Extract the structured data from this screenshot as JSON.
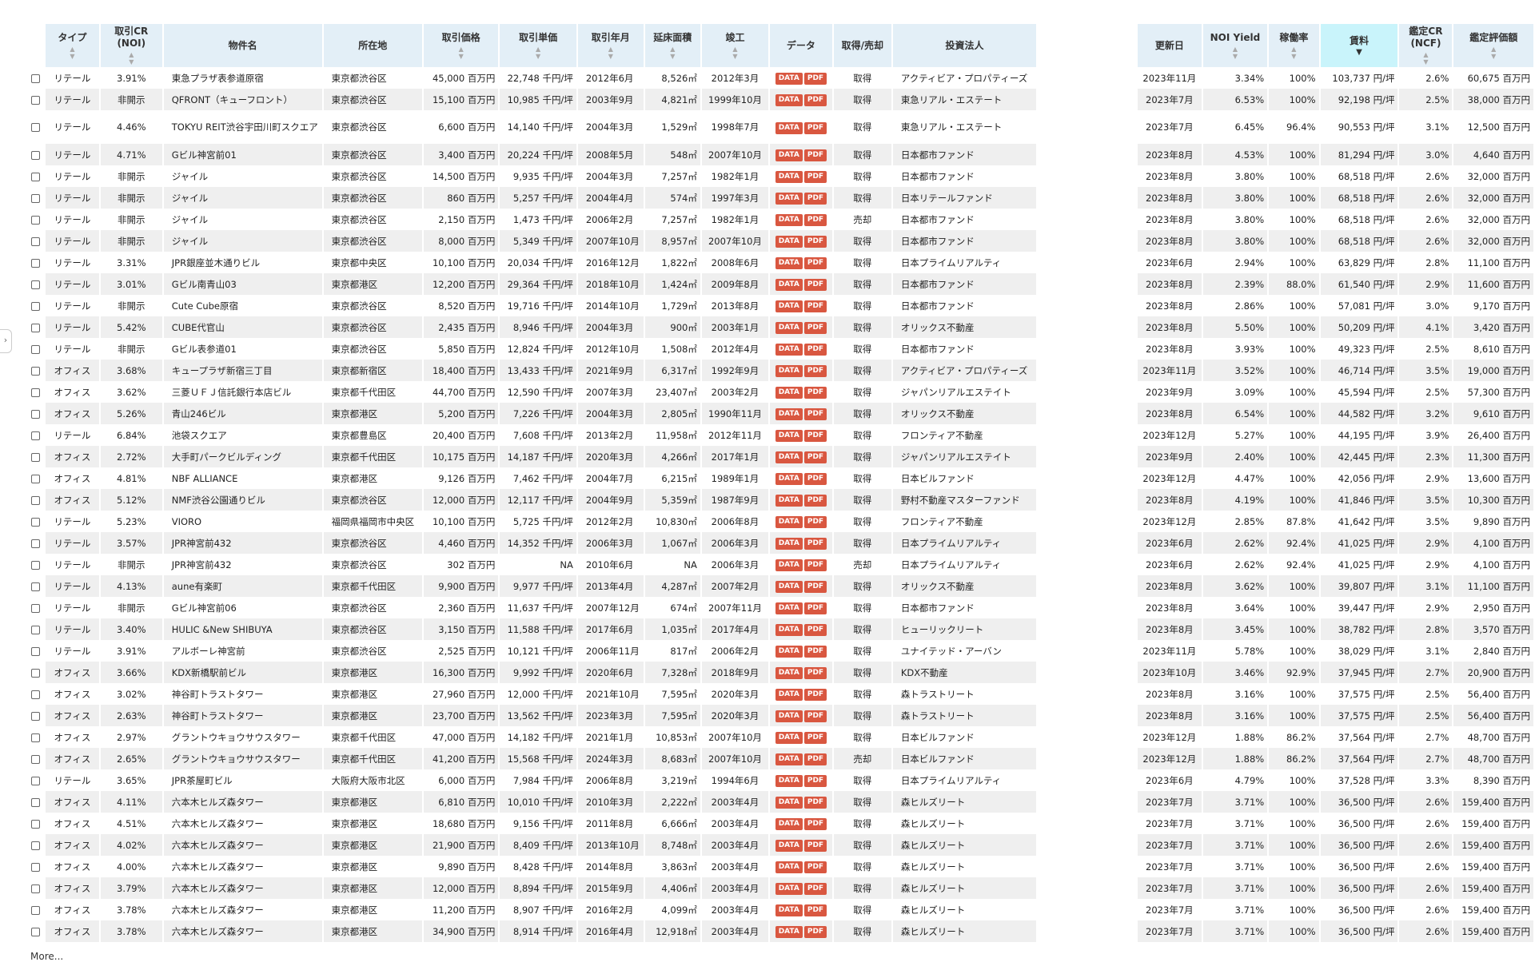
{
  "more_label": "More...",
  "sidebar_toggle": "›",
  "headers": {
    "type": "タイプ",
    "cr_noi_1": "取引CR",
    "cr_noi_2": "(NOI)",
    "name": "物件名",
    "location": "所在地",
    "price": "取引価格",
    "unit_price": "取引単価",
    "date": "取引年月",
    "area": "延床面積",
    "built": "竣工",
    "data": "データ",
    "acq": "取得/売却",
    "investor": "投資法人",
    "updated": "更新日",
    "noi_yield": "NOI Yield",
    "occupancy": "稼働率",
    "rent": "賃料",
    "cr_ncf_1": "鑑定CR",
    "cr_ncf_2": "(NCF)",
    "appraisal": "鑑定評価額"
  },
  "buttons": {
    "data": "DATA",
    "pdf": "PDF"
  },
  "colors": {
    "header_bg": "#e3eff7",
    "sorted_header_bg": "#c9f4fb",
    "row_alt_bg": "#efefef",
    "button": "#d95740"
  },
  "rows": [
    [
      "リテール",
      "3.91%",
      "東急プラザ表参道原宿",
      "東京都渋谷区",
      "45,000 百万円",
      "22,748 千円/坪",
      "2012年6月",
      "8,526㎡",
      "2012年3月",
      "取得",
      "アクティビア・プロパティーズ",
      "2023年11月",
      "3.34%",
      "100%",
      "103,737 円/坪",
      "2.6%",
      "60,675 百万円"
    ],
    [
      "リテール",
      "非開示",
      "QFRONT（キューフロント）",
      "東京都渋谷区",
      "15,100 百万円",
      "10,985 千円/坪",
      "2003年9月",
      "4,821㎡",
      "1999年10月",
      "取得",
      "東急リアル・エステート",
      "2023年7月",
      "6.53%",
      "100%",
      "92,198 円/坪",
      "2.5%",
      "38,000 百万円"
    ],
    [
      "リテール",
      "4.46%",
      "TOKYU REIT渋谷宇田川町スクエア",
      "東京都渋谷区",
      "6,600 百万円",
      "14,140 千円/坪",
      "2004年3月",
      "1,529㎡",
      "1998年7月",
      "取得",
      "東急リアル・エステート",
      "2023年7月",
      "6.45%",
      "96.4%",
      "90,553 円/坪",
      "3.1%",
      "12,500 百万円"
    ],
    [
      "リテール",
      "4.71%",
      "Gビル神宮前01",
      "東京都渋谷区",
      "3,400 百万円",
      "20,224 千円/坪",
      "2008年5月",
      "548㎡",
      "2007年10月",
      "取得",
      "日本都市ファンド",
      "2023年8月",
      "4.53%",
      "100%",
      "81,294 円/坪",
      "3.0%",
      "4,640 百万円"
    ],
    [
      "リテール",
      "非開示",
      "ジャイル",
      "東京都渋谷区",
      "14,500 百万円",
      "9,935 千円/坪",
      "2004年3月",
      "7,257㎡",
      "1982年1月",
      "取得",
      "日本都市ファンド",
      "2023年8月",
      "3.80%",
      "100%",
      "68,518 円/坪",
      "2.6%",
      "32,000 百万円"
    ],
    [
      "リテール",
      "非開示",
      "ジャイル",
      "東京都渋谷区",
      "860 百万円",
      "5,257 千円/坪",
      "2004年4月",
      "574㎡",
      "1997年3月",
      "取得",
      "日本リテールファンド",
      "2023年8月",
      "3.80%",
      "100%",
      "68,518 円/坪",
      "2.6%",
      "32,000 百万円"
    ],
    [
      "リテール",
      "非開示",
      "ジャイル",
      "東京都渋谷区",
      "2,150 百万円",
      "1,473 千円/坪",
      "2006年2月",
      "7,257㎡",
      "1982年1月",
      "売却",
      "日本都市ファンド",
      "2023年8月",
      "3.80%",
      "100%",
      "68,518 円/坪",
      "2.6%",
      "32,000 百万円"
    ],
    [
      "リテール",
      "非開示",
      "ジャイル",
      "東京都渋谷区",
      "8,000 百万円",
      "5,349 千円/坪",
      "2007年10月",
      "8,957㎡",
      "2007年10月",
      "取得",
      "日本都市ファンド",
      "2023年8月",
      "3.80%",
      "100%",
      "68,518 円/坪",
      "2.6%",
      "32,000 百万円"
    ],
    [
      "リテール",
      "3.31%",
      "JPR銀座並木通りビル",
      "東京都中央区",
      "10,100 百万円",
      "20,034 千円/坪",
      "2016年12月",
      "1,822㎡",
      "2008年6月",
      "取得",
      "日本プライムリアルティ",
      "2023年6月",
      "2.94%",
      "100%",
      "63,829 円/坪",
      "2.8%",
      "11,100 百万円"
    ],
    [
      "リテール",
      "3.01%",
      "Gビル南青山03",
      "東京都港区",
      "12,200 百万円",
      "29,364 千円/坪",
      "2018年10月",
      "1,424㎡",
      "2009年8月",
      "取得",
      "日本都市ファンド",
      "2023年8月",
      "2.39%",
      "88.0%",
      "61,540 円/坪",
      "2.9%",
      "11,600 百万円"
    ],
    [
      "リテール",
      "非開示",
      "Cute Cube原宿",
      "東京都渋谷区",
      "8,520 百万円",
      "19,716 千円/坪",
      "2014年10月",
      "1,729㎡",
      "2013年8月",
      "取得",
      "日本都市ファンド",
      "2023年8月",
      "2.86%",
      "100%",
      "57,081 円/坪",
      "3.0%",
      "9,170 百万円"
    ],
    [
      "リテール",
      "5.42%",
      "CUBE代官山",
      "東京都渋谷区",
      "2,435 百万円",
      "8,946 千円/坪",
      "2004年3月",
      "900㎡",
      "2003年1月",
      "取得",
      "オリックス不動産",
      "2023年8月",
      "5.50%",
      "100%",
      "50,209 円/坪",
      "4.1%",
      "3,420 百万円"
    ],
    [
      "リテール",
      "非開示",
      "Gビル表参道01",
      "東京都渋谷区",
      "5,850 百万円",
      "12,824 千円/坪",
      "2012年10月",
      "1,508㎡",
      "2012年4月",
      "取得",
      "日本都市ファンド",
      "2023年8月",
      "3.93%",
      "100%",
      "49,323 円/坪",
      "2.5%",
      "8,610 百万円"
    ],
    [
      "オフィス",
      "3.68%",
      "キュープラザ新宿三丁目",
      "東京都新宿区",
      "18,400 百万円",
      "13,433 千円/坪",
      "2021年9月",
      "6,317㎡",
      "1992年9月",
      "取得",
      "アクティビア・プロパティーズ",
      "2023年11月",
      "3.52%",
      "100%",
      "46,714 円/坪",
      "3.5%",
      "19,000 百万円"
    ],
    [
      "オフィス",
      "3.62%",
      "三菱ＵＦＪ信託銀行本店ビル",
      "東京都千代田区",
      "44,700 百万円",
      "12,590 千円/坪",
      "2007年3月",
      "23,407㎡",
      "2003年2月",
      "取得",
      "ジャパンリアルエステイト",
      "2023年9月",
      "3.09%",
      "100%",
      "45,594 円/坪",
      "2.5%",
      "57,300 百万円"
    ],
    [
      "オフィス",
      "5.26%",
      "青山246ビル",
      "東京都港区",
      "5,200 百万円",
      "7,226 千円/坪",
      "2004年3月",
      "2,805㎡",
      "1990年11月",
      "取得",
      "オリックス不動産",
      "2023年8月",
      "6.54%",
      "100%",
      "44,582 円/坪",
      "3.2%",
      "9,610 百万円"
    ],
    [
      "リテール",
      "6.84%",
      "池袋スクエア",
      "東京都豊島区",
      "20,400 百万円",
      "7,608 千円/坪",
      "2013年2月",
      "11,958㎡",
      "2012年11月",
      "取得",
      "フロンティア不動産",
      "2023年12月",
      "5.27%",
      "100%",
      "44,195 円/坪",
      "3.9%",
      "26,400 百万円"
    ],
    [
      "オフィス",
      "2.72%",
      "大手町パークビルディング",
      "東京都千代田区",
      "10,175 百万円",
      "14,187 千円/坪",
      "2020年3月",
      "4,266㎡",
      "2017年1月",
      "取得",
      "ジャパンリアルエステイト",
      "2023年9月",
      "2.40%",
      "100%",
      "42,445 円/坪",
      "2.3%",
      "11,300 百万円"
    ],
    [
      "オフィス",
      "4.81%",
      "NBF ALLIANCE",
      "東京都港区",
      "9,126 百万円",
      "7,462 千円/坪",
      "2004年7月",
      "6,215㎡",
      "1989年1月",
      "取得",
      "日本ビルファンド",
      "2023年12月",
      "4.47%",
      "100%",
      "42,056 円/坪",
      "2.9%",
      "13,600 百万円"
    ],
    [
      "オフィス",
      "5.12%",
      "NMF渋谷公園通りビル",
      "東京都渋谷区",
      "12,000 百万円",
      "12,117 千円/坪",
      "2004年9月",
      "5,359㎡",
      "1987年9月",
      "取得",
      "野村不動産マスターファンド",
      "2023年8月",
      "4.19%",
      "100%",
      "41,846 円/坪",
      "3.5%",
      "10,300 百万円"
    ],
    [
      "リテール",
      "5.23%",
      "VIORO",
      "福岡県福岡市中央区",
      "10,100 百万円",
      "5,725 千円/坪",
      "2012年2月",
      "10,830㎡",
      "2006年8月",
      "取得",
      "フロンティア不動産",
      "2023年12月",
      "2.85%",
      "87.8%",
      "41,642 円/坪",
      "3.5%",
      "9,890 百万円"
    ],
    [
      "リテール",
      "3.57%",
      "JPR神宮前432",
      "東京都渋谷区",
      "4,460 百万円",
      "14,352 千円/坪",
      "2006年3月",
      "1,067㎡",
      "2006年3月",
      "取得",
      "日本プライムリアルティ",
      "2023年6月",
      "2.62%",
      "92.4%",
      "41,025 円/坪",
      "2.9%",
      "4,100 百万円"
    ],
    [
      "リテール",
      "非開示",
      "JPR神宮前432",
      "東京都渋谷区",
      "302 百万円",
      "NA",
      "2010年6月",
      "NA",
      "2006年3月",
      "売却",
      "日本プライムリアルティ",
      "2023年6月",
      "2.62%",
      "92.4%",
      "41,025 円/坪",
      "2.9%",
      "4,100 百万円"
    ],
    [
      "リテール",
      "4.13%",
      "aune有楽町",
      "東京都千代田区",
      "9,900 百万円",
      "9,977 千円/坪",
      "2013年4月",
      "4,287㎡",
      "2007年2月",
      "取得",
      "オリックス不動産",
      "2023年8月",
      "3.62%",
      "100%",
      "39,807 円/坪",
      "3.1%",
      "11,100 百万円"
    ],
    [
      "リテール",
      "非開示",
      "Gビル神宮前06",
      "東京都渋谷区",
      "2,360 百万円",
      "11,637 千円/坪",
      "2007年12月",
      "674㎡",
      "2007年11月",
      "取得",
      "日本都市ファンド",
      "2023年8月",
      "3.64%",
      "100%",
      "39,447 円/坪",
      "2.9%",
      "2,950 百万円"
    ],
    [
      "リテール",
      "3.40%",
      "HULIC &New SHIBUYA",
      "東京都渋谷区",
      "3,150 百万円",
      "11,588 千円/坪",
      "2017年6月",
      "1,035㎡",
      "2017年4月",
      "取得",
      "ヒューリックリート",
      "2023年8月",
      "3.45%",
      "100%",
      "38,782 円/坪",
      "2.8%",
      "3,570 百万円"
    ],
    [
      "リテール",
      "3.91%",
      "アルボーレ神宮前",
      "東京都渋谷区",
      "2,525 百万円",
      "10,121 千円/坪",
      "2006年11月",
      "817㎡",
      "2006年2月",
      "取得",
      "ユナイテッド・アーバン",
      "2023年11月",
      "5.78%",
      "100%",
      "38,029 円/坪",
      "3.1%",
      "2,840 百万円"
    ],
    [
      "オフィス",
      "3.66%",
      "KDX新橋駅前ビル",
      "東京都港区",
      "16,300 百万円",
      "9,992 千円/坪",
      "2020年6月",
      "7,328㎡",
      "2018年9月",
      "取得",
      "KDX不動産",
      "2023年10月",
      "3.46%",
      "92.9%",
      "37,945 円/坪",
      "2.7%",
      "20,900 百万円"
    ],
    [
      "オフィス",
      "3.02%",
      "神谷町トラストタワー",
      "東京都港区",
      "27,960 百万円",
      "12,000 千円/坪",
      "2021年10月",
      "7,595㎡",
      "2020年3月",
      "取得",
      "森トラストリート",
      "2023年8月",
      "3.16%",
      "100%",
      "37,575 円/坪",
      "2.5%",
      "56,400 百万円"
    ],
    [
      "オフィス",
      "2.63%",
      "神谷町トラストタワー",
      "東京都港区",
      "23,700 百万円",
      "13,562 千円/坪",
      "2023年3月",
      "7,595㎡",
      "2020年3月",
      "取得",
      "森トラストリート",
      "2023年8月",
      "3.16%",
      "100%",
      "37,575 円/坪",
      "2.5%",
      "56,400 百万円"
    ],
    [
      "オフィス",
      "2.97%",
      "グラントウキョウサウスタワー",
      "東京都千代田区",
      "47,000 百万円",
      "14,182 千円/坪",
      "2021年1月",
      "10,853㎡",
      "2007年10月",
      "取得",
      "日本ビルファンド",
      "2023年12月",
      "1.88%",
      "86.2%",
      "37,564 円/坪",
      "2.7%",
      "48,700 百万円"
    ],
    [
      "オフィス",
      "2.65%",
      "グラントウキョウサウスタワー",
      "東京都千代田区",
      "41,200 百万円",
      "15,568 千円/坪",
      "2024年3月",
      "8,683㎡",
      "2007年10月",
      "売却",
      "日本ビルファンド",
      "2023年12月",
      "1.88%",
      "86.2%",
      "37,564 円/坪",
      "2.7%",
      "48,700 百万円"
    ],
    [
      "リテール",
      "3.65%",
      "JPR茶屋町ビル",
      "大阪府大阪市北区",
      "6,000 百万円",
      "7,984 千円/坪",
      "2006年8月",
      "3,219㎡",
      "1994年6月",
      "取得",
      "日本プライムリアルティ",
      "2023年6月",
      "4.79%",
      "100%",
      "37,528 円/坪",
      "3.3%",
      "8,390 百万円"
    ],
    [
      "オフィス",
      "4.11%",
      "六本木ヒルズ森タワー",
      "東京都港区",
      "6,810 百万円",
      "10,010 千円/坪",
      "2010年3月",
      "2,222㎡",
      "2003年4月",
      "取得",
      "森ヒルズリート",
      "2023年7月",
      "3.71%",
      "100%",
      "36,500 円/坪",
      "2.6%",
      "159,400 百万円"
    ],
    [
      "オフィス",
      "4.51%",
      "六本木ヒルズ森タワー",
      "東京都港区",
      "18,680 百万円",
      "9,156 千円/坪",
      "2011年8月",
      "6,666㎡",
      "2003年4月",
      "取得",
      "森ヒルズリート",
      "2023年7月",
      "3.71%",
      "100%",
      "36,500 円/坪",
      "2.6%",
      "159,400 百万円"
    ],
    [
      "オフィス",
      "4.02%",
      "六本木ヒルズ森タワー",
      "東京都港区",
      "21,900 百万円",
      "8,409 千円/坪",
      "2013年10月",
      "8,748㎡",
      "2003年4月",
      "取得",
      "森ヒルズリート",
      "2023年7月",
      "3.71%",
      "100%",
      "36,500 円/坪",
      "2.6%",
      "159,400 百万円"
    ],
    [
      "オフィス",
      "4.00%",
      "六本木ヒルズ森タワー",
      "東京都港区",
      "9,890 百万円",
      "8,428 千円/坪",
      "2014年8月",
      "3,863㎡",
      "2003年4月",
      "取得",
      "森ヒルズリート",
      "2023年7月",
      "3.71%",
      "100%",
      "36,500 円/坪",
      "2.6%",
      "159,400 百万円"
    ],
    [
      "オフィス",
      "3.79%",
      "六本木ヒルズ森タワー",
      "東京都港区",
      "12,000 百万円",
      "8,894 千円/坪",
      "2015年9月",
      "4,406㎡",
      "2003年4月",
      "取得",
      "森ヒルズリート",
      "2023年7月",
      "3.71%",
      "100%",
      "36,500 円/坪",
      "2.6%",
      "159,400 百万円"
    ],
    [
      "オフィス",
      "3.78%",
      "六本木ヒルズ森タワー",
      "東京都港区",
      "11,200 百万円",
      "8,907 千円/坪",
      "2016年2月",
      "4,099㎡",
      "2003年4月",
      "取得",
      "森ヒルズリート",
      "2023年7月",
      "3.71%",
      "100%",
      "36,500 円/坪",
      "2.6%",
      "159,400 百万円"
    ],
    [
      "オフィス",
      "3.78%",
      "六本木ヒルズ森タワー",
      "東京都港区",
      "34,900 百万円",
      "8,914 千円/坪",
      "2016年4月",
      "12,918㎡",
      "2003年4月",
      "取得",
      "森ヒルズリート",
      "2023年7月",
      "3.71%",
      "100%",
      "36,500 円/坪",
      "2.6%",
      "159,400 百万円"
    ]
  ]
}
